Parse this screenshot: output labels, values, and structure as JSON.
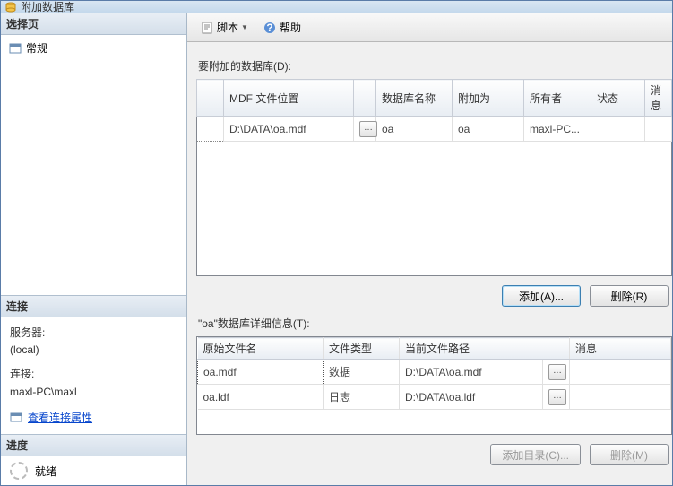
{
  "titlebar": {
    "text": "附加数据库"
  },
  "left": {
    "select_label": "选择页",
    "general": "常规",
    "conn_header": "连接",
    "server_label": "服务器:",
    "server_value": "(local)",
    "conn_label": "连接:",
    "conn_value": "maxl-PC\\maxl",
    "conn_props": "查看连接属性",
    "progress_header": "进度",
    "progress_status": "就绪"
  },
  "toolbar": {
    "script": "脚本",
    "help": "帮助"
  },
  "sections": {
    "attach_label": "要附加的数据库(D):",
    "details_label": "\"oa\"数据库详细信息(T):"
  },
  "grid1": {
    "headers": {
      "c1": "MDF 文件位置",
      "c3": "数据库名称",
      "c4": "附加为",
      "c5": "所有者",
      "c6": "状态",
      "c7": "消息"
    },
    "rows": [
      {
        "loc": "D:\\DATA\\oa.mdf",
        "db": "oa",
        "as": "oa",
        "owner": "maxl-PC..."
      }
    ]
  },
  "buttons": {
    "add": "添加(A)...",
    "remove": "删除(R)",
    "add_dir": "添加目录(C)...",
    "delete": "删除(M)"
  },
  "grid2": {
    "headers": {
      "c0": "原始文件名",
      "c1": "文件类型",
      "c2": "当前文件路径",
      "c4": "消息"
    },
    "rows": [
      {
        "name": "oa.mdf",
        "type": "数据",
        "path": "D:\\DATA\\oa.mdf"
      },
      {
        "name": "oa.ldf",
        "type": "日志",
        "path": "D:\\DATA\\oa.ldf"
      }
    ]
  }
}
